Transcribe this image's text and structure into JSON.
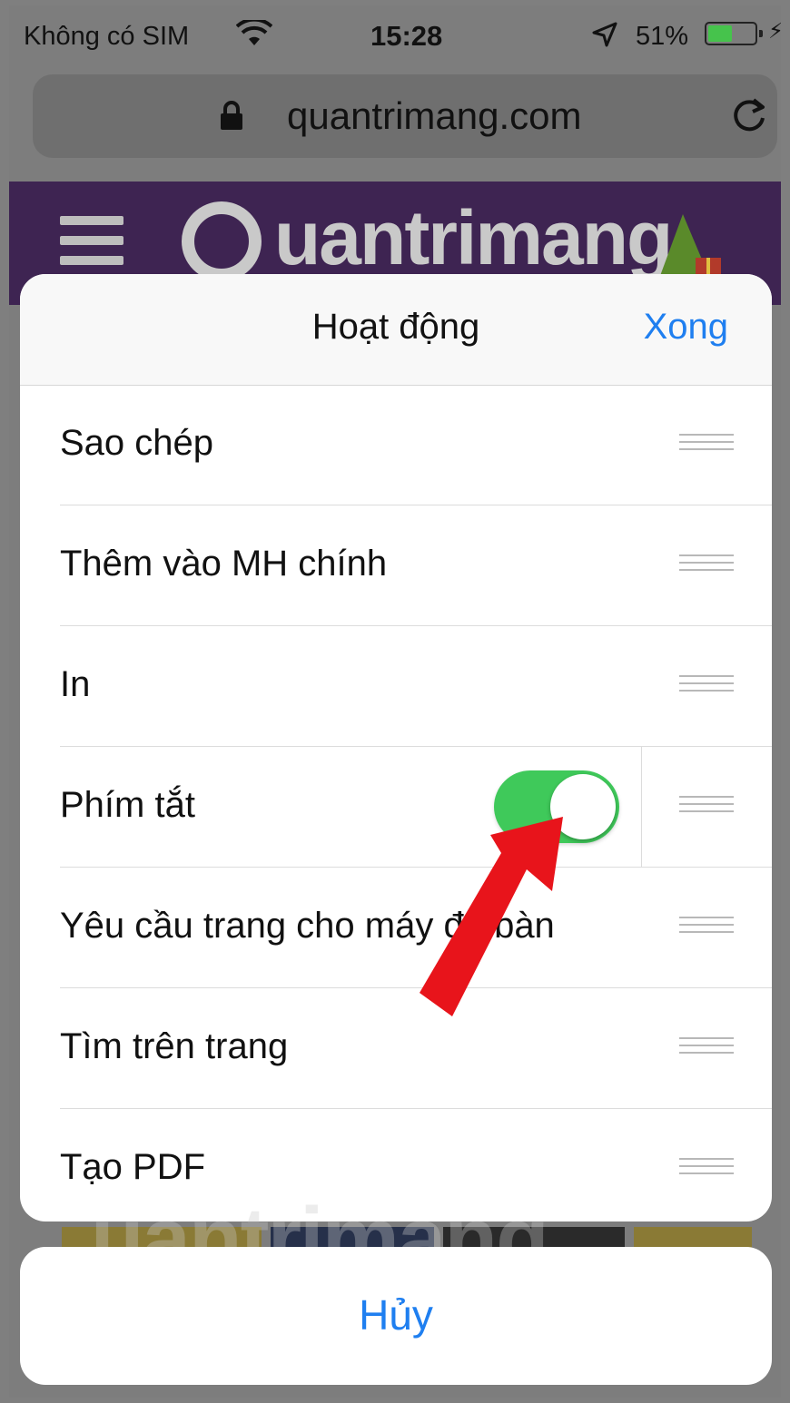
{
  "status_bar": {
    "carrier": "Không có SIM",
    "time": "15:28",
    "battery_percent": "51%",
    "battery_level": 0.51,
    "icons": [
      "wifi-icon",
      "location-arrow-icon",
      "battery-icon",
      "charging-bolt-icon"
    ]
  },
  "browser": {
    "url": "quantrimang.com",
    "icons": [
      "lock-icon",
      "reload-icon"
    ]
  },
  "site": {
    "brand": "uantrimang",
    "icons": [
      "hamburger-menu-icon",
      "quantrimang-logo-icon",
      "christmas-tree-icon"
    ]
  },
  "sheet": {
    "title": "Hoạt động",
    "done_label": "Xong",
    "items": [
      {
        "label": "Sao chép"
      },
      {
        "label": "Thêm vào MH chính"
      },
      {
        "label": "In"
      },
      {
        "label": "Phím tắt",
        "toggle_on": true
      },
      {
        "label": "Yêu cầu trang cho máy để bàn"
      },
      {
        "label": "Tìm trên trang"
      },
      {
        "label": "Tạo PDF"
      }
    ]
  },
  "cancel_label": "Hủy",
  "watermark": "uantrimang",
  "colors": {
    "accent": "#1f7ff0",
    "toggle_on": "#3fc95a",
    "banner": "#3e2452",
    "annotation_arrow": "#e8141b"
  }
}
